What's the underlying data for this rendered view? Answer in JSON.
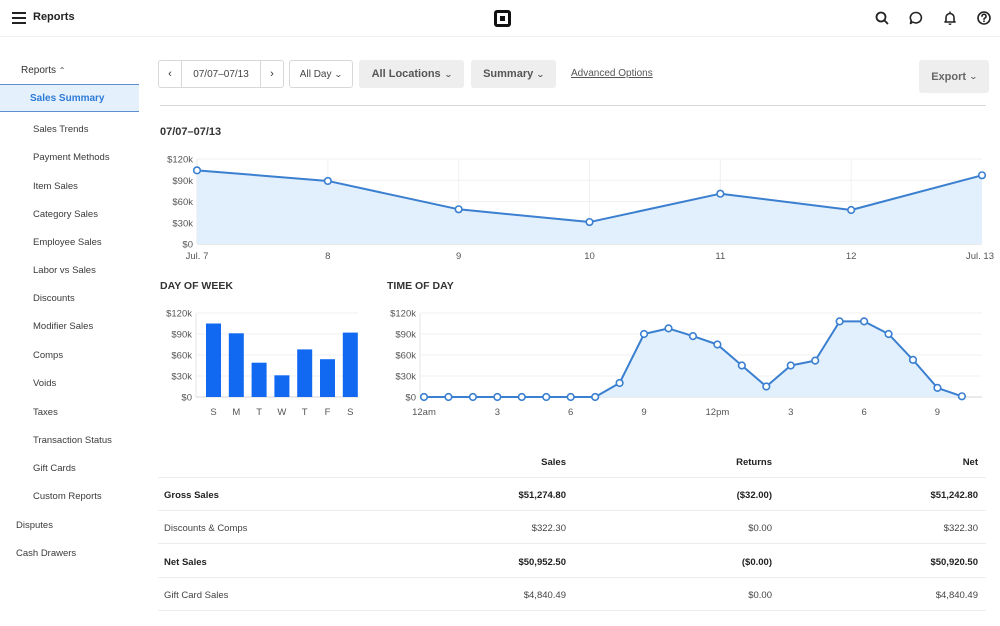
{
  "header": {
    "app_title": "Reports",
    "icons": [
      "menu-icon",
      "square-logo-icon",
      "search-icon",
      "chat-icon",
      "bell-icon",
      "help-icon"
    ]
  },
  "sidebar": {
    "group_label": "Reports",
    "active_item": "Sales Summary",
    "items": [
      "Sales Trends",
      "Payment Methods",
      "Item Sales",
      "Category Sales",
      "Employee Sales",
      "Labor vs Sales",
      "Discounts",
      "Modifier Sales",
      "Comps",
      "Voids",
      "Taxes",
      "Transaction Status",
      "Gift Cards",
      "Custom Reports"
    ],
    "top_items": [
      "Disputes",
      "Cash Drawers"
    ]
  },
  "toolbar": {
    "prev_label": "‹",
    "date_range": "07/07–07/13",
    "next_label": "›",
    "time_filter": "All Day",
    "location_filter": "All Locations",
    "report_type": "Summary",
    "advanced_link": "Advanced Options",
    "export_label": "Export"
  },
  "range_title": "07/07–07/13",
  "sections": {
    "day_of_week": "DAY OF WEEK",
    "time_of_day": "TIME OF DAY"
  },
  "colors": {
    "accent": "#2e7bd8",
    "line": "#3a7fd0",
    "area": "#e2effc",
    "bar": "#1169f2"
  },
  "chart_data": [
    {
      "type": "area",
      "title": "07/07–07/13",
      "x": [
        "Jul. 7",
        "8",
        "9",
        "10",
        "11",
        "12",
        "Jul. 13"
      ],
      "values": [
        104000,
        89000,
        49000,
        31000,
        71000,
        48000,
        97000
      ],
      "yticks": [
        "$0",
        "$30k",
        "$60k",
        "$90k",
        "$120k"
      ],
      "ylim": [
        0,
        120000
      ],
      "grid": true
    },
    {
      "type": "bar",
      "title": "DAY OF WEEK",
      "categories": [
        "S",
        "M",
        "T",
        "W",
        "T",
        "F",
        "S"
      ],
      "values": [
        105000,
        91000,
        49000,
        31000,
        68000,
        54000,
        92000
      ],
      "yticks": [
        "$0",
        "$30k",
        "$60k",
        "$90k",
        "$120k"
      ],
      "ylim": [
        0,
        120000
      ],
      "grid": true
    },
    {
      "type": "area",
      "title": "TIME OF DAY",
      "x": [
        0,
        1,
        2,
        3,
        4,
        5,
        6,
        7,
        8,
        9,
        10,
        11,
        12,
        13,
        14,
        15,
        16,
        17,
        18,
        19,
        20,
        21,
        22
      ],
      "values": [
        0,
        0,
        0,
        0,
        0,
        0,
        0,
        0,
        20000,
        90000,
        98000,
        87000,
        75000,
        45000,
        15000,
        45000,
        52000,
        108000,
        108000,
        90000,
        53000,
        13000,
        1000
      ],
      "xtick_labels": [
        {
          "hour": 0,
          "label": "12am"
        },
        {
          "hour": 3,
          "label": "3"
        },
        {
          "hour": 6,
          "label": "6"
        },
        {
          "hour": 9,
          "label": "9"
        },
        {
          "hour": 12,
          "label": "12pm"
        },
        {
          "hour": 15,
          "label": "3"
        },
        {
          "hour": 18,
          "label": "6"
        },
        {
          "hour": 21,
          "label": "9"
        }
      ],
      "yticks": [
        "$0",
        "$30k",
        "$60k",
        "$90k",
        "$120k"
      ],
      "ylim": [
        0,
        120000
      ],
      "grid": true
    }
  ],
  "table": {
    "headers": [
      "",
      "Sales",
      "Returns",
      "Net"
    ],
    "rows": [
      {
        "label": "Gross Sales",
        "sales": "$51,274.80",
        "returns": "($32.00)",
        "net": "$51,242.80",
        "bold": true
      },
      {
        "label": "Discounts & Comps",
        "sales": "$322.30",
        "returns": "$0.00",
        "net": "$322.30",
        "bold": false
      },
      {
        "label": "Net Sales",
        "sales": "$50,952.50",
        "returns": "($0.00)",
        "net": "$50,920.50",
        "bold": true
      },
      {
        "label": "Gift Card Sales",
        "sales": "$4,840.49",
        "returns": "$0.00",
        "net": "$4,840.49",
        "bold": false
      }
    ]
  }
}
